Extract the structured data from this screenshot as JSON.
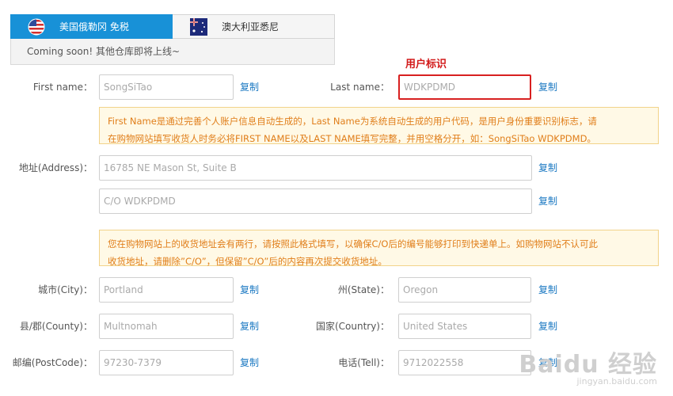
{
  "tabs": [
    {
      "label": "美国俄勒冈 免税",
      "flag": "us-flag-icon"
    },
    {
      "label": "澳大利亚悉尼",
      "flag": "au-flag-icon"
    }
  ],
  "notice": "Coming soon! 其他仓库即将上线~",
  "annotation": "用户标识",
  "copy_label": "复制",
  "fields": {
    "first_name": {
      "label": "First name：",
      "value": "SongSiTao"
    },
    "last_name": {
      "label": "Last name：",
      "value": "WDKPDMD"
    },
    "address": {
      "label": "地址(Address)：",
      "line1": "16785 NE Mason St, Suite B",
      "line2": "C/O WDKPDMD"
    },
    "city": {
      "label": "城市(City)：",
      "value": "Portland"
    },
    "state": {
      "label": "州(State)：",
      "value": "Oregon"
    },
    "county": {
      "label": "县/郡(County)：",
      "value": "Multnomah"
    },
    "country": {
      "label": "国家(Country)：",
      "value": "United States"
    },
    "postcode": {
      "label": "邮编(PostCode)：",
      "value": "97230-7379"
    },
    "tel": {
      "label": "电话(Tell)：",
      "value": "9712022558"
    }
  },
  "tips": {
    "name_line1": "First Name是通过完善个人账户信息自动生成的，Last Name为系统自动生成的用户代码，是用户身份重要识别标志，请",
    "name_line2": "在购物网站填写收货人时务必将FIRST NAME以及LAST NAME填写完整，并用空格分开，如：SongSiTao WDKPDMD。",
    "address_line1": "您在购物网站上的收货地址会有两行，请按照此格式填写，以确保C/O后的编号能够打印到快递单上。如购物网站不认可此",
    "address_line2": "收货地址，请删除”C/O”，但保留”C/O”后的内容再次提交收货地址。"
  },
  "watermark": {
    "brand": "Baidu 经验",
    "url": "jingyan.baidu.com"
  },
  "colors": {
    "tab_active": "#1891d7",
    "copy_link": "#1a78c2",
    "tip_text": "#e07e1a",
    "annotation": "#d21a1a"
  }
}
